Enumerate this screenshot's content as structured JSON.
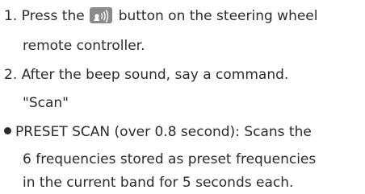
{
  "colors": {
    "text": "#2b2b2b",
    "button_bg": "#8a8a8a",
    "button_glyph": "#ffffff",
    "bullet": "#2b2b2b"
  },
  "step1": {
    "number": "1.",
    "before_button": "Press the",
    "button_icon": "voice-command-icon",
    "after_button": "button on the steering wheel",
    "continuation": "remote controller."
  },
  "step2": {
    "number": "2.",
    "text": "After the beep sound, say a command.",
    "command": "\"Scan\""
  },
  "note": {
    "line1": "PRESET SCAN (over 0.8 second): Scans the",
    "line2": "6 frequencies stored as preset frequencies",
    "line3": "in the current band for 5 seconds each."
  }
}
